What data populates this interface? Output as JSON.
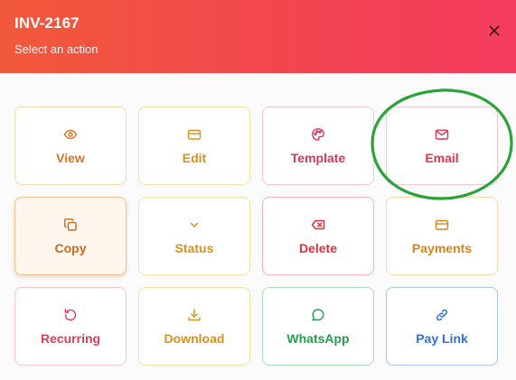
{
  "dialog": {
    "title": "INV-2167",
    "subtitle": "Select an action",
    "close_icon": "close-icon"
  },
  "actions": [
    {
      "label": "View",
      "icon": "eye-icon",
      "color": "#d9731f",
      "border": "#f7d9a8"
    },
    {
      "label": "Edit",
      "icon": "card-icon",
      "color": "#d9901a",
      "border": "#f7e0a0"
    },
    {
      "label": "Template",
      "icon": "palette-icon",
      "color": "#d6365a",
      "border": "#f6c3cf"
    },
    {
      "label": "Email",
      "icon": "mail-icon",
      "color": "#e0344a",
      "border": "#f6c5cd"
    },
    {
      "label": "Copy",
      "icon": "copy-icon",
      "color": "#c86a1e",
      "border": "#f0c08f"
    },
    {
      "label": "Status",
      "icon": "chevron-down-icon",
      "color": "#d9901a",
      "border": "#f7e0a0"
    },
    {
      "label": "Delete",
      "icon": "backspace-icon",
      "color": "#dc2f3b",
      "border": "#f3b4b9"
    },
    {
      "label": "Payments",
      "icon": "card-icon",
      "color": "#d9821a",
      "border": "#f7d9a8"
    },
    {
      "label": "Recurring",
      "icon": "refresh-icon",
      "color": "#dc3b5a",
      "border": "#f6c3cf"
    },
    {
      "label": "Download",
      "icon": "download-icon",
      "color": "#d9901a",
      "border": "#f7e0a0"
    },
    {
      "label": "WhatsApp",
      "icon": "chat-icon",
      "color": "#22a050",
      "border": "#a9dfb7"
    },
    {
      "label": "Pay Link",
      "icon": "link-icon",
      "color": "#2f6fd6",
      "border": "#a9c5ef"
    }
  ],
  "selected_action": "Copy",
  "annotation": {
    "highlighted_action": "Email",
    "color": "#2aa33a"
  }
}
